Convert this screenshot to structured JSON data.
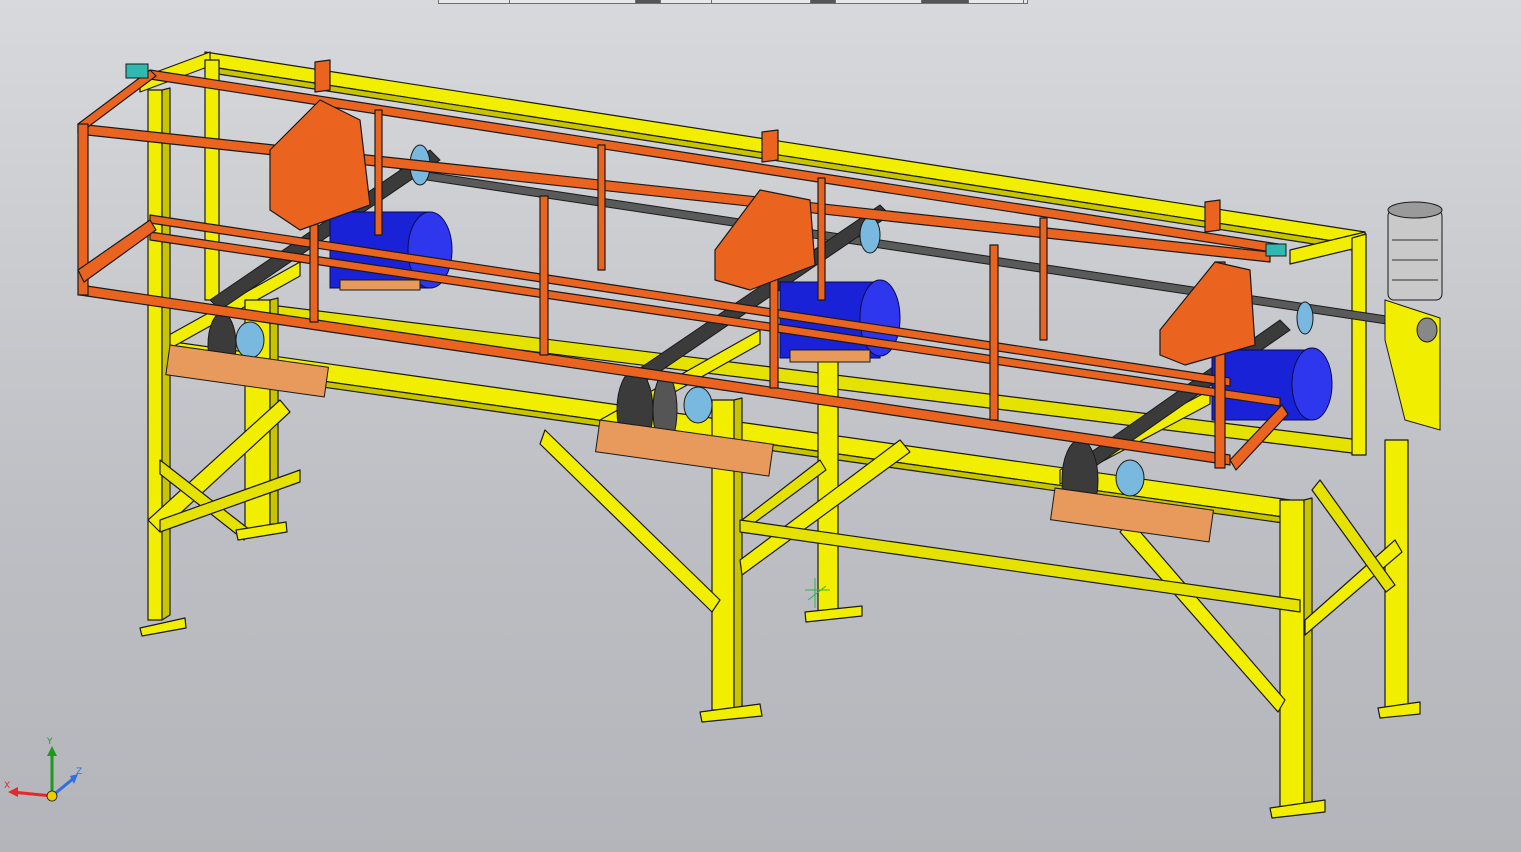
{
  "viewport": {
    "background_top": "#d8d9dc",
    "background_bottom": "#b3b5ba"
  },
  "colors": {
    "frame": "#f2ee00",
    "frame_shade": "#c9c400",
    "guard": "#ea6420",
    "guard_dark": "#b8481a",
    "motor": "#1a22d8",
    "plate": "#e79a5c",
    "sprocket": "#3b3b3b",
    "bearing": "#79b9e0",
    "edge": "#1a1a1a"
  },
  "toolbar": {
    "segments": 9,
    "dark_segments": [
      2,
      5,
      7
    ]
  },
  "axis_triad": {
    "x_label": "X",
    "y_label": "Y",
    "z_label": "Z",
    "x_color": "#e02a2a",
    "y_color": "#1f9a1f",
    "z_color": "#2f6fe0",
    "origin_color": "#e8d000"
  },
  "model": {
    "motor_count": 3,
    "drive_motor_icon": "gear-motor-icon"
  }
}
